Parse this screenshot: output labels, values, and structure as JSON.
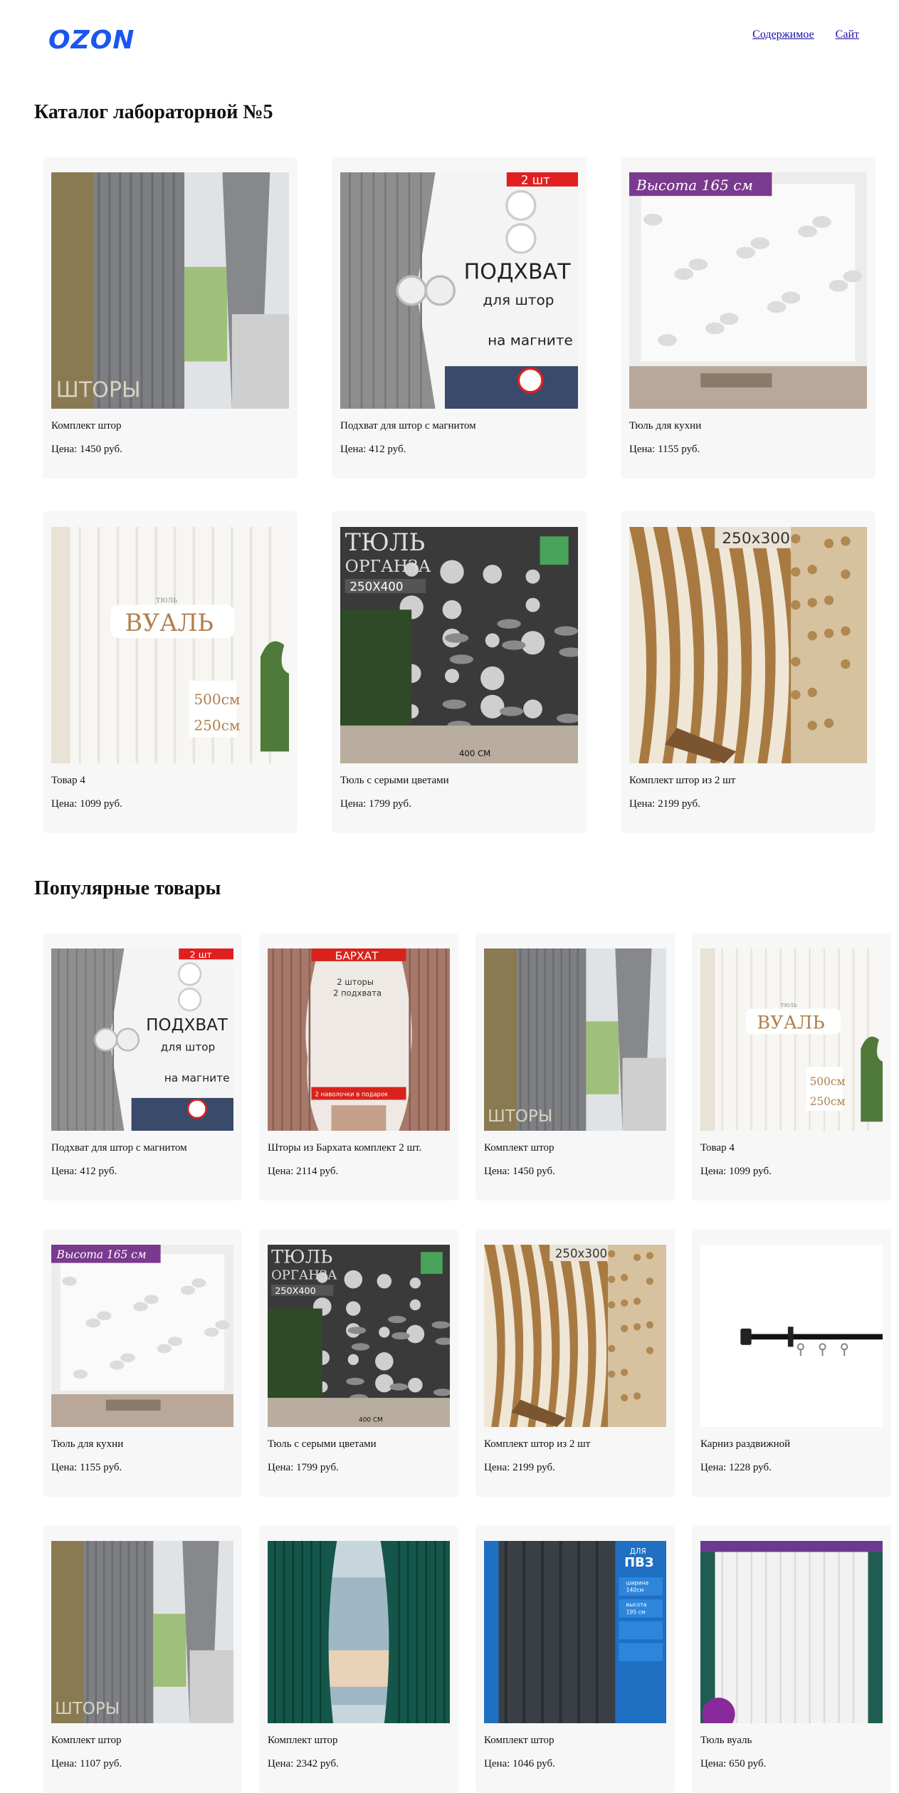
{
  "header": {
    "logo": "OZON",
    "nav": [
      "Содержимое",
      "Сайт"
    ]
  },
  "catalog": {
    "title": "Каталог лабораторной №5",
    "items": [
      {
        "name": "Комплект штор",
        "price": "Цена: 1450 руб.",
        "img": "grey-curtain"
      },
      {
        "name": "Подхват для штор с магнитом",
        "price": "Цена: 412 руб.",
        "img": "tieback"
      },
      {
        "name": "Тюль для кухни",
        "price": "Цена: 1155 руб.",
        "img": "kitchen-tulle"
      },
      {
        "name": "Товар 4",
        "price": "Цена: 1099 руб.",
        "img": "voile"
      },
      {
        "name": "Тюль с серыми цветами",
        "price": "Цена: 1799 руб.",
        "img": "flower-tulle"
      },
      {
        "name": "Комплект штор из 2 шт",
        "price": "Цена: 2199 руб.",
        "img": "beige-curtain"
      }
    ]
  },
  "popular": {
    "title": "Популярные товары",
    "items": [
      {
        "name": "Подхват для штор с магнитом",
        "price": "Цена: 412 руб.",
        "img": "tieback"
      },
      {
        "name": "Шторы из Бархата комплект 2 шт.",
        "price": "Цена: 2114 руб.",
        "img": "velvet"
      },
      {
        "name": "Комплект штор",
        "price": "Цена: 1450 руб.",
        "img": "grey-curtain"
      },
      {
        "name": "Товар 4",
        "price": "Цена: 1099 руб.",
        "img": "voile"
      },
      {
        "name": "Тюль для кухни",
        "price": "Цена: 1155 руб.",
        "img": "kitchen-tulle"
      },
      {
        "name": "Тюль с серыми цветами",
        "price": "Цена: 1799 руб.",
        "img": "flower-tulle"
      },
      {
        "name": "Комплект штор из 2 шт",
        "price": "Цена: 2199 руб.",
        "img": "beige-curtain"
      },
      {
        "name": "Карниз раздвижной",
        "price": "Цена: 1228 руб.",
        "img": "rod"
      },
      {
        "name": "Комплект штор",
        "price": "Цена: 1107 руб.",
        "img": "grey-curtain"
      },
      {
        "name": "Комплект штор",
        "price": "Цена: 2342 руб.",
        "img": "green-curtain"
      },
      {
        "name": "Комплект штор",
        "price": "Цена: 1046 руб.",
        "img": "dark-curtain"
      },
      {
        "name": "Тюль вуаль",
        "price": "Цена: 650 руб.",
        "img": "white-tulle"
      }
    ]
  },
  "image_text": {
    "grey-curtain": "ШТОРЫ",
    "tieback": [
      "2 шт",
      "ПОДХВАТ",
      "для штор",
      "на магните"
    ],
    "kitchen-tulle": "Высота 165 см",
    "voile": [
      "тюль",
      "ВУАЛЬ",
      "500см",
      "250см"
    ],
    "flower-tulle": [
      "ТЮЛЬ",
      "ОРГАНЗА",
      "250X400",
      "400 СМ"
    ],
    "beige-curtain": "250x300",
    "velvet": [
      "БАРХАТ",
      "2 шторы",
      "2 подхвата",
      "2 наволочки в подарок"
    ],
    "dark-curtain": [
      "ДЛЯ",
      "ПВЗ",
      "ширина",
      "140см",
      "высота",
      "195 см"
    ]
  }
}
